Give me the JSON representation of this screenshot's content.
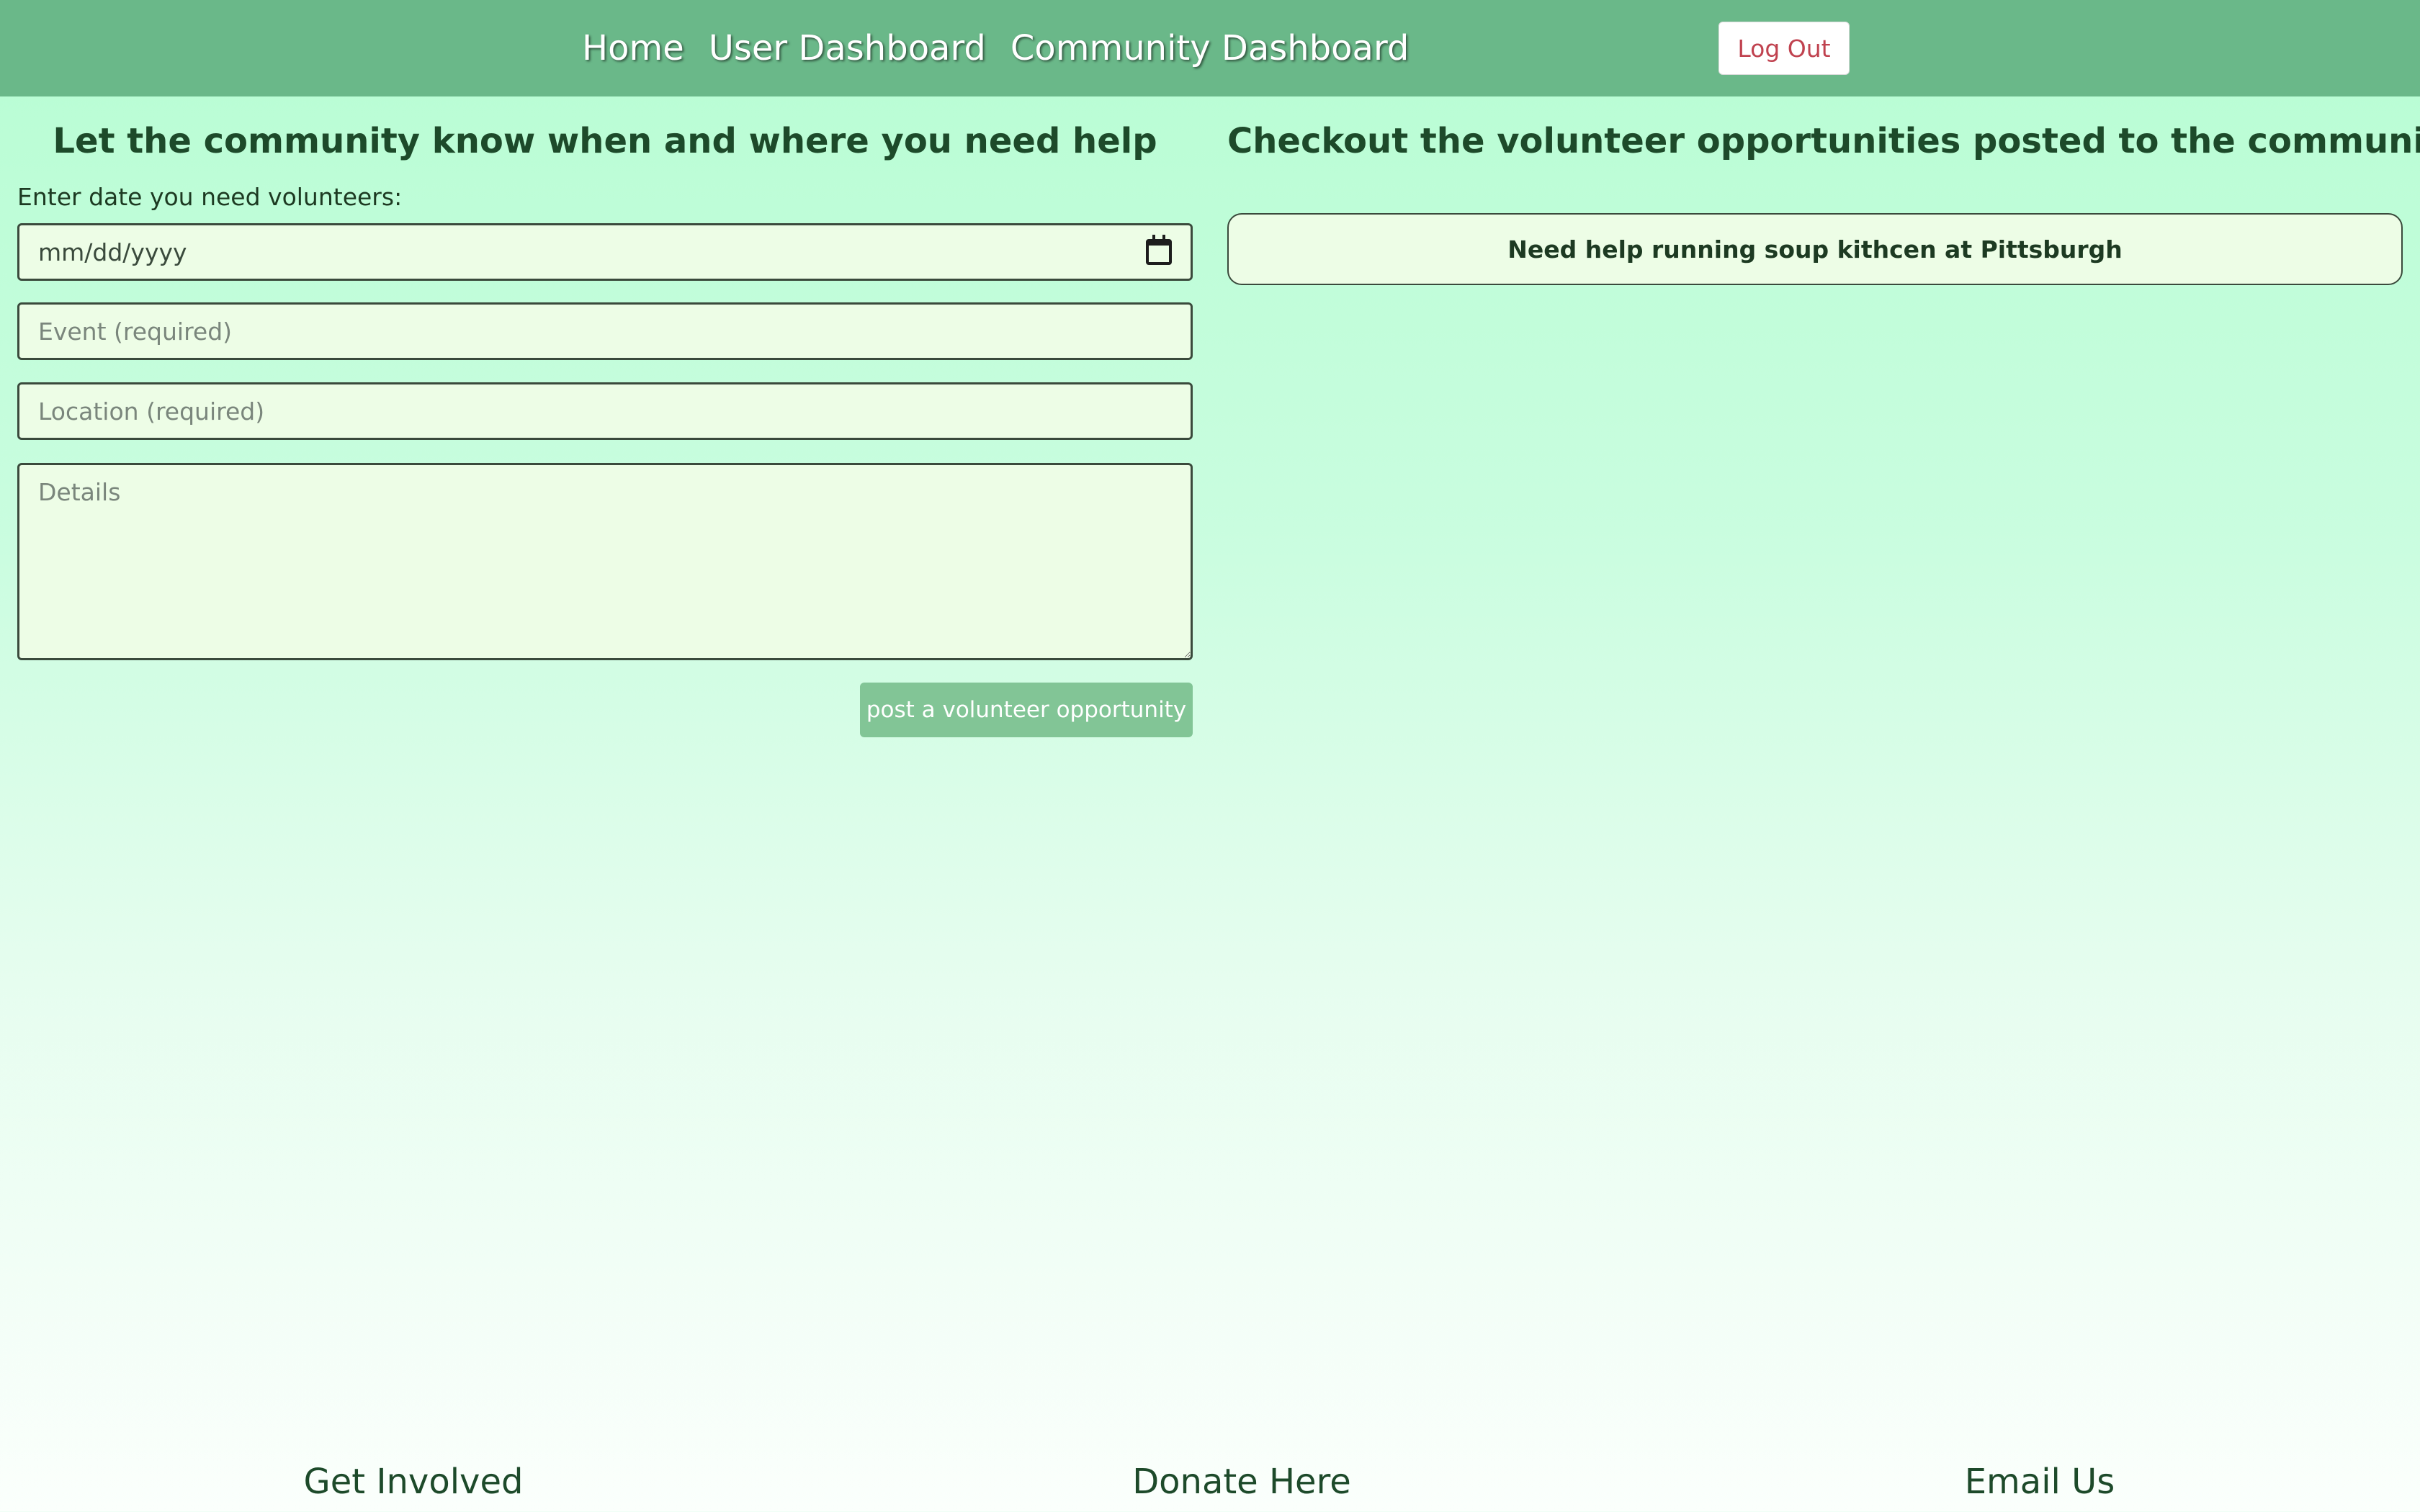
{
  "navbar": {
    "links": [
      {
        "label": "Home"
      },
      {
        "label": "User Dashboard"
      },
      {
        "label": "Community Dashboard"
      }
    ],
    "logout_label": "Log Out"
  },
  "form": {
    "heading": "Let the community know when and where you need help",
    "date_label": "Enter date you need volunteers:",
    "date_placeholder": "mm/dd/yyyy",
    "event_placeholder": "Event (required)",
    "location_placeholder": "Location (required)",
    "details_placeholder": "Details",
    "submit_label": "post a volunteer opportunity"
  },
  "opportunities": {
    "heading": "Checkout the volunteer opportunities posted to the community",
    "items": [
      {
        "title": "Need help running soup kithcen at Pittsburgh"
      }
    ]
  },
  "footer": {
    "links": [
      {
        "label": "Get Involved"
      },
      {
        "label": "Donate Here"
      },
      {
        "label": "Email Us"
      }
    ]
  },
  "colors": {
    "navbar": "#6ab889",
    "accent_button": "#82c596",
    "logout_text": "#c0424f",
    "field_bg": "#edfde6"
  }
}
